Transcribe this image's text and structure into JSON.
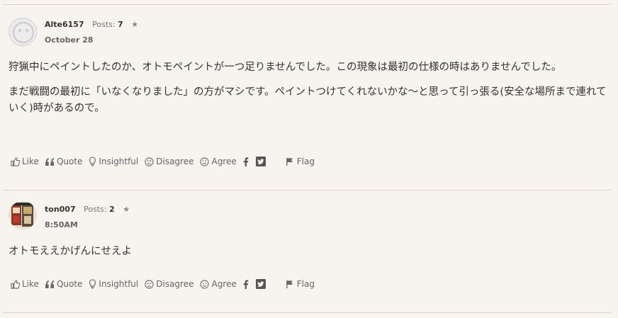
{
  "posts": [
    {
      "username": "Alte6157",
      "posts_label": "Posts:",
      "posts_count": "7",
      "date": "October 28",
      "body": [
        "狩猟中にペイントしたのか、オトモペイントが一つ足りませんでした。この現象は最初の仕様の時はありませんでした。",
        "まだ戦闘の最初に「いなくなりました」の方がマシです。ペイントつけてくれないかな～と思って引っ張る(安全な場所まで連れていく)時があるので。"
      ],
      "avatar_icon": "default-avatar-icon"
    },
    {
      "username": "ton007",
      "posts_label": "Posts:",
      "posts_count": "2",
      "date": "8:50AM",
      "body": [
        "オトモええかげんにせえよ"
      ],
      "avatar_icon": "user-avatar-image"
    }
  ],
  "reactions": {
    "like": "Like",
    "quote": "Quote",
    "insightful": "Insightful",
    "disagree": "Disagree",
    "agree": "Agree",
    "flag": "Flag"
  },
  "colors": {
    "background": "#f7f3ee",
    "divider": "#d8d2ca",
    "text": "#333333",
    "muted": "#666666"
  }
}
